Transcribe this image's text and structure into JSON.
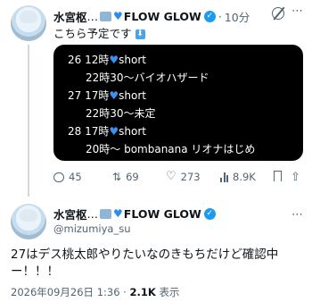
{
  "tweet": {
    "author_name": "水宮枢",
    "ellipsis": "…",
    "brand": "FLOW GLOW",
    "dot": "·",
    "time": "10分",
    "text": "こちら予定です",
    "arrow_emoji": "⬇",
    "schedule": [
      {
        "date_time": "26 12時",
        "label": "short",
        "detail": "22時30～バイオハザード"
      },
      {
        "date_time": "27 17時",
        "label": "short",
        "detail": "22時30～未定"
      },
      {
        "date_time": "28 17時",
        "label": "short",
        "detail": "20時～ bombanana リオナはじめ"
      }
    ],
    "actions": {
      "replies": "45",
      "retweets": "69",
      "likes": "273",
      "views": "8.9K"
    }
  },
  "reply": {
    "author_name": "水宮枢",
    "ellipsis": "…",
    "brand": "FLOW GLOW",
    "handle": "@mizumiya_su",
    "text": "27はデス桃太郎やりたいなのきもちだけど確認中ー！！！",
    "timestamp": "2026年09月26日 1:36",
    "dot": "·",
    "views": "2.1K",
    "views_label": "表示"
  },
  "colors": {
    "accent": "#1d9bf0",
    "text": "#0f1419",
    "secondary": "#536471"
  }
}
